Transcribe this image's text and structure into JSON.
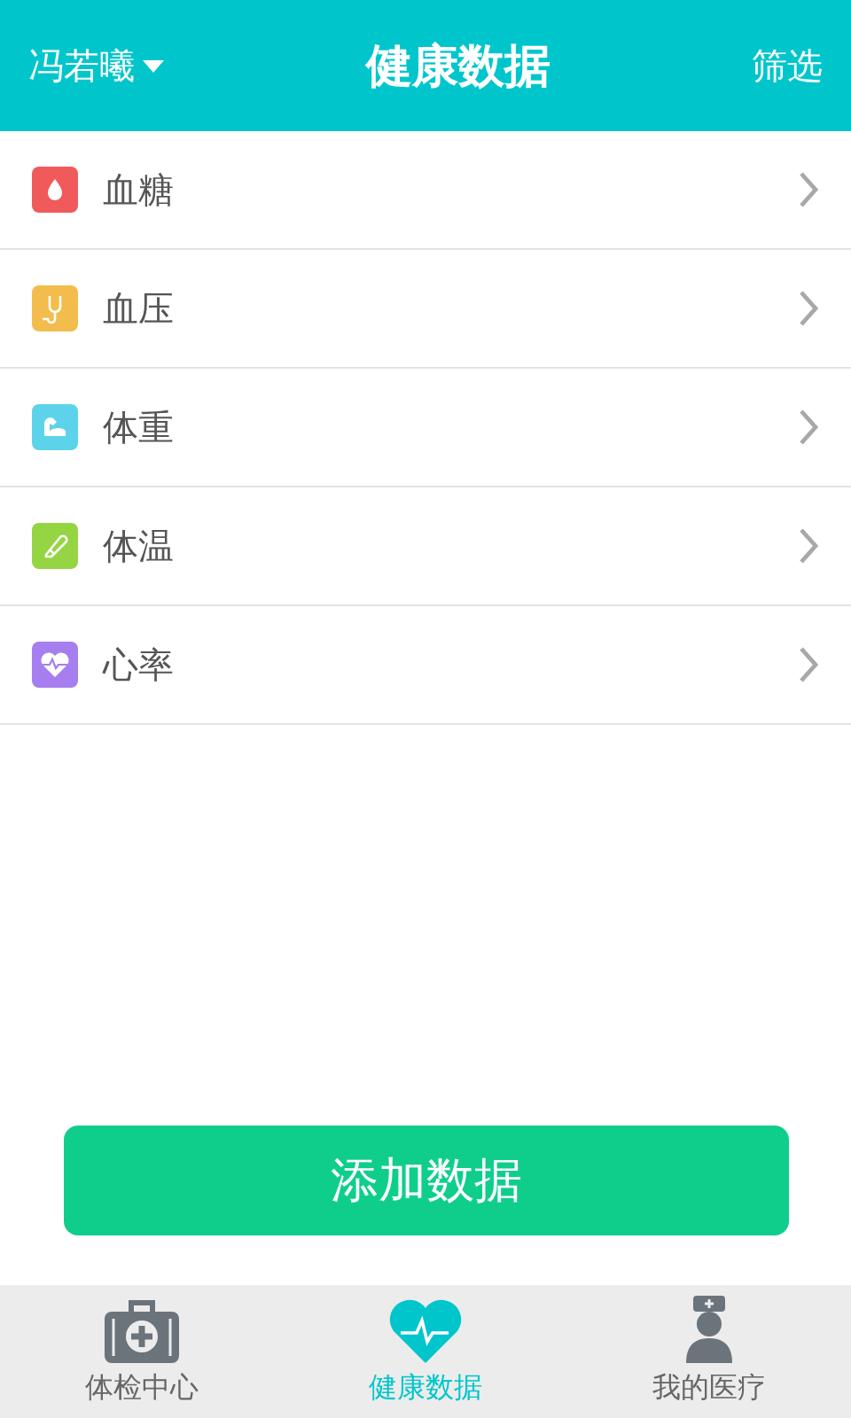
{
  "header": {
    "user": "冯若曦",
    "title": "健康数据",
    "action": "筛选"
  },
  "items": [
    {
      "label": "血糖",
      "kind": "drop",
      "color": "#f05a5a"
    },
    {
      "label": "血压",
      "kind": "stethoscope",
      "color": "#f2bd4c"
    },
    {
      "label": "体重",
      "kind": "arm",
      "color": "#5cd3ea"
    },
    {
      "label": "体温",
      "kind": "thermometer",
      "color": "#95d543"
    },
    {
      "label": "心率",
      "kind": "heart",
      "color": "#a67ef0"
    }
  ],
  "add_button": "添加数据",
  "tabs": [
    {
      "label": "体检中心",
      "kind": "medkit",
      "selected": false
    },
    {
      "label": "健康数据",
      "kind": "heart",
      "selected": true
    },
    {
      "label": "我的医疗",
      "kind": "nurse",
      "selected": false
    }
  ]
}
